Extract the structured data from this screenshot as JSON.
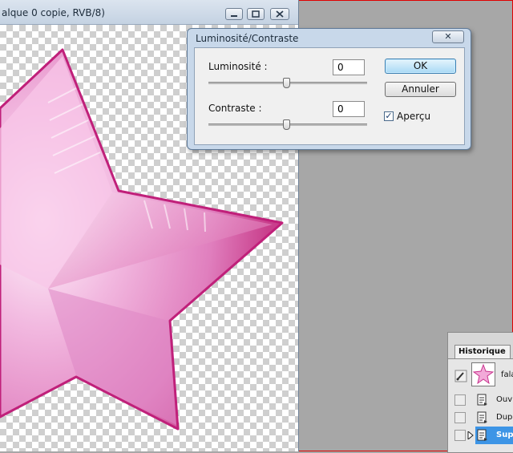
{
  "document": {
    "title": "alque 0 copie, RVB/8)"
  },
  "dialog": {
    "title": "Luminosité/Contraste",
    "close_label": "✕",
    "brightness": {
      "label": "Luminosité :",
      "value": "0"
    },
    "contrast": {
      "label": "Contraste :",
      "value": "0"
    },
    "ok_label": "OK",
    "cancel_label": "Annuler",
    "preview_label": "Aperçu",
    "preview_checked": "✓"
  },
  "history": {
    "tab_label": "Historique",
    "snapshot_label": "fala",
    "items": [
      {
        "label": "Ouv"
      },
      {
        "label": "Dup"
      },
      {
        "label": "Sup"
      }
    ]
  },
  "colors": {
    "star_pink": "#d9509b",
    "star_light": "#f6c7e6",
    "selection": "#3d95e6"
  }
}
